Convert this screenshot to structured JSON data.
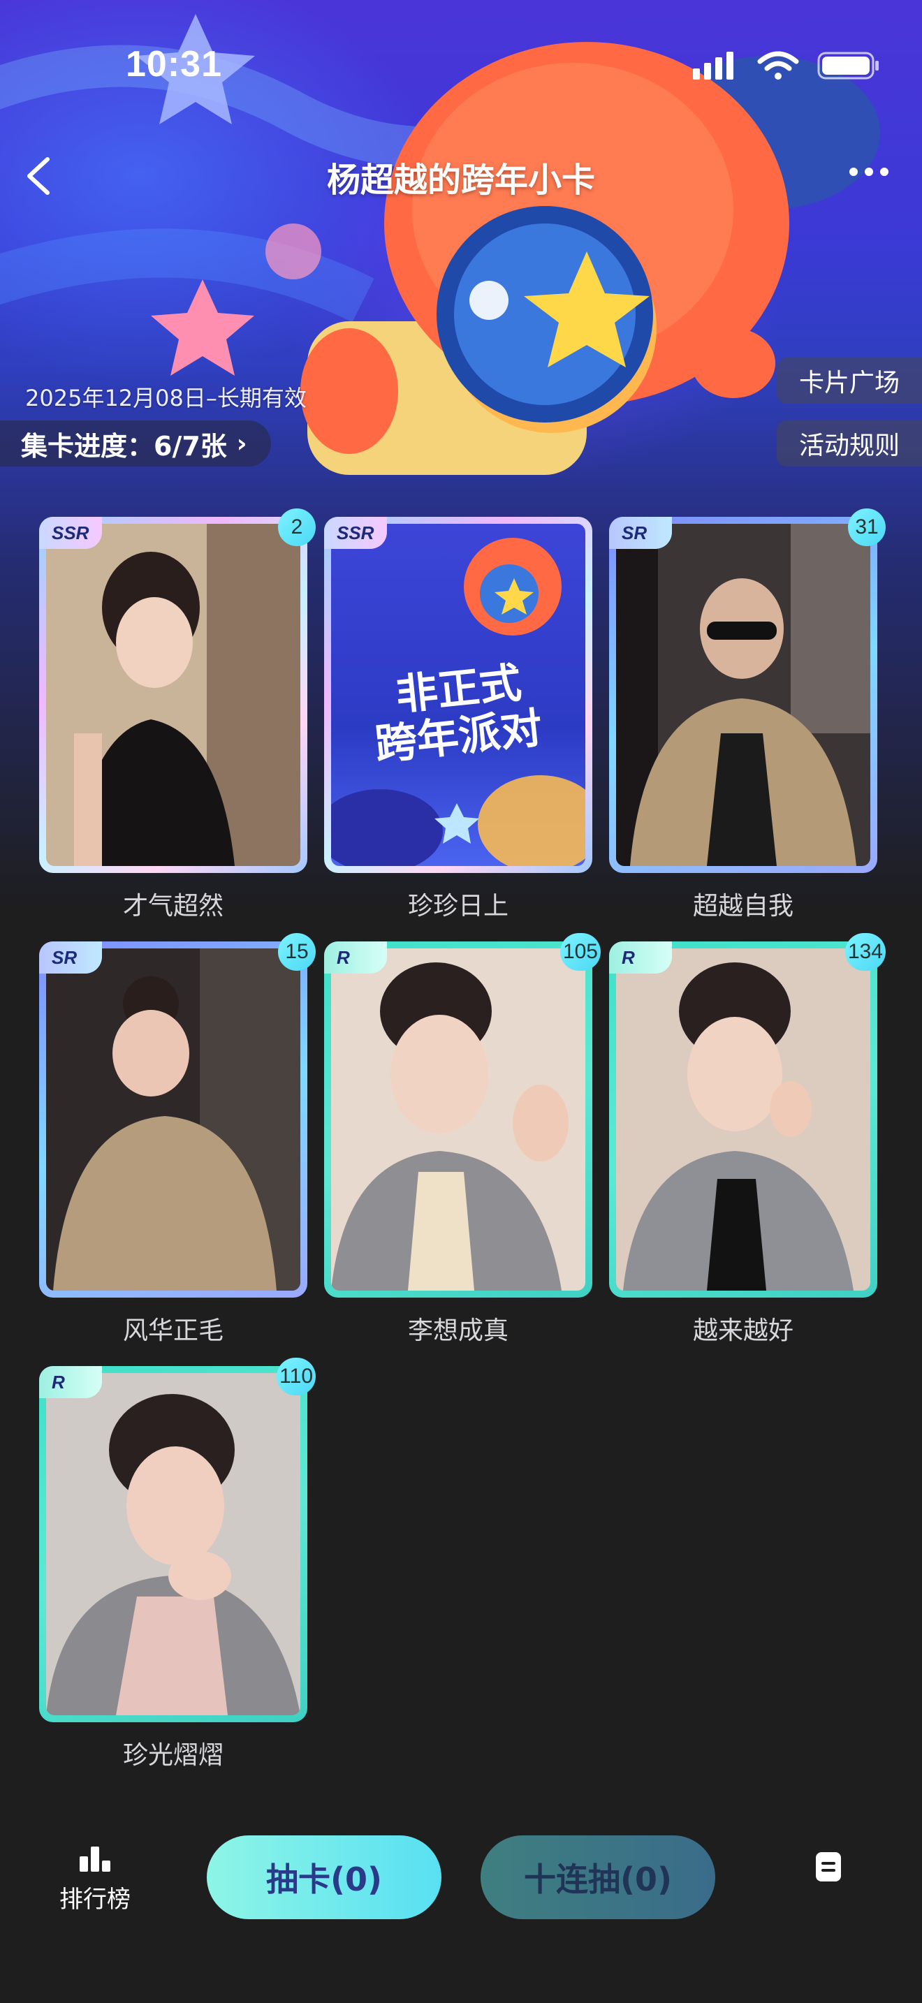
{
  "status_bar": {
    "time": "10:31"
  },
  "nav": {
    "title": "杨超越的跨年小卡"
  },
  "info": {
    "validity": "2025年12月08日–长期有效",
    "progress": "集卡进度：6/7张",
    "plaza_button": "卡片广场",
    "rules_button": "活动规则"
  },
  "cards": [
    {
      "name": "才气超然",
      "rarity": "SSR",
      "count": "2"
    },
    {
      "name": "珍珍日上",
      "rarity": "SSR",
      "count": "",
      "poster_line1": "非正式",
      "poster_line2": "跨年派对"
    },
    {
      "name": "超越自我",
      "rarity": "SR",
      "count": "31"
    },
    {
      "name": "风华正毛",
      "rarity": "SR",
      "count": "15"
    },
    {
      "name": "李想成真",
      "rarity": "R",
      "count": "105"
    },
    {
      "name": "越来越好",
      "rarity": "R",
      "count": "134"
    },
    {
      "name": "珍光熠熠",
      "rarity": "R",
      "count": "110"
    }
  ],
  "bottom_bar": {
    "ranking_label": "排行榜",
    "draw_one": "抽卡(0)",
    "draw_ten": "十连抽(0)"
  },
  "colors": {
    "page_background": "#1e1e1f",
    "ssr_frame": "#f0b8ff",
    "sr_frame": "#7fd8ff",
    "r_frame": "#3fe0c8",
    "primary_button": "#58e0f2"
  }
}
